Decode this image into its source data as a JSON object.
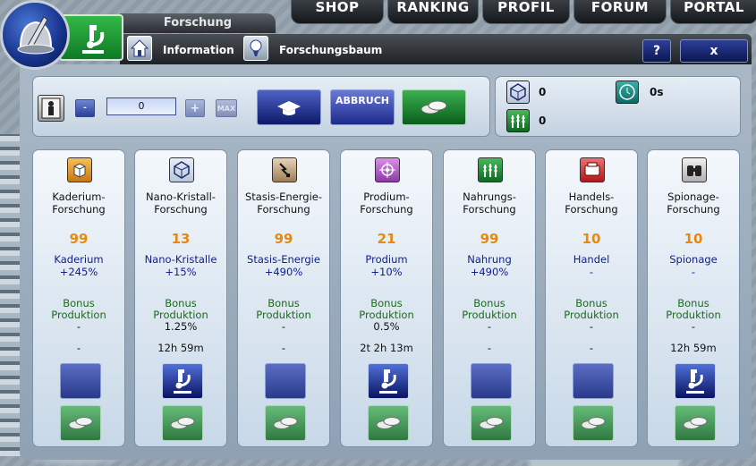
{
  "nav": {
    "items": [
      "SHOP",
      "RANKING",
      "PROFIL",
      "FORUM",
      "PORTAL"
    ]
  },
  "header": {
    "title": "Forschung",
    "tabs": [
      {
        "label": "Information"
      },
      {
        "label": "Forschungsbaum"
      }
    ],
    "help_label": "?",
    "close_label": "x"
  },
  "controls": {
    "amount_value": "0",
    "minus_label": "-",
    "plus_label": "+",
    "max_label": "MAX",
    "abort_label": "ABBRUCH"
  },
  "stats": {
    "nanocrystal": "0",
    "time": "0s",
    "food": "0"
  },
  "colors": {
    "level": "#e58a10",
    "resource": "#12208a",
    "bonus": "#1d6a1d"
  },
  "research": [
    {
      "name": "Kaderium-\nForschung",
      "level": "99",
      "resource": "Kaderium",
      "percent": "+245%",
      "bonus": "Bonus\nProduktion",
      "bonus_value": "-",
      "time": "-",
      "active": false,
      "icon": "box-icon"
    },
    {
      "name": "Nano-Kristall-\nForschung",
      "level": "13",
      "resource": "Nano-Kristalle",
      "percent": "+15%",
      "bonus": "Bonus\nProduktion",
      "bonus_value": "1.25%",
      "time": "12h 59m",
      "active": true,
      "icon": "crystal-icon"
    },
    {
      "name": "Stasis-Energie-\nForschung",
      "level": "99",
      "resource": "Stasis-Energie",
      "percent": "+490%",
      "bonus": "Bonus\nProduktion",
      "bonus_value": "-",
      "time": "-",
      "active": false,
      "icon": "energy-icon"
    },
    {
      "name": "Prodium-\nForschung",
      "level": "21",
      "resource": "Prodium",
      "percent": "+10%",
      "bonus": "Bonus\nProduktion",
      "bonus_value": "0.5%",
      "time": "2t 2h 13m",
      "active": true,
      "icon": "prodium-icon"
    },
    {
      "name": "Nahrungs-\nForschung",
      "level": "99",
      "resource": "Nahrung",
      "percent": "+490%",
      "bonus": "Bonus\nProduktion",
      "bonus_value": "-",
      "time": "-",
      "active": false,
      "icon": "food-icon"
    },
    {
      "name": "Handels-\nForschung",
      "level": "10",
      "resource": "Handel",
      "percent": "-",
      "bonus": "Bonus\nProduktion",
      "bonus_value": "-",
      "time": "-",
      "active": false,
      "icon": "trade-icon"
    },
    {
      "name": "Spionage-\nForschung",
      "level": "10",
      "resource": "Spionage",
      "percent": "-",
      "bonus": "Bonus\nProduktion",
      "bonus_value": "-",
      "time": "12h 59m",
      "active": true,
      "icon": "spy-icon"
    }
  ]
}
